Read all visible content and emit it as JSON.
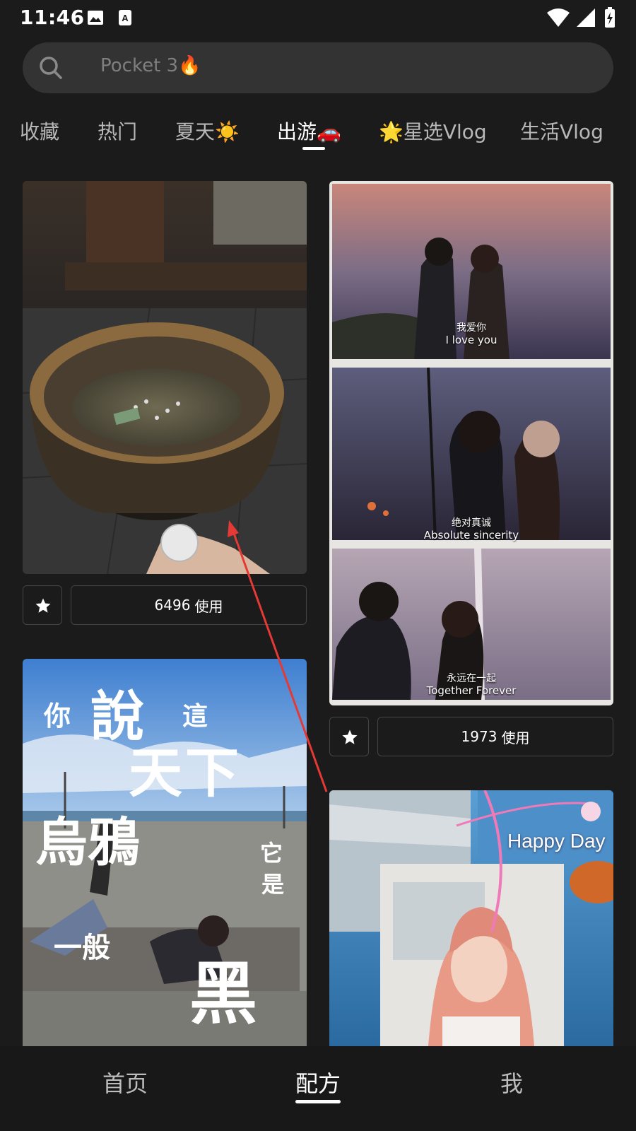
{
  "status_bar": {
    "time": "11:46",
    "icons": [
      "image-icon",
      "font-icon",
      "wifi-icon",
      "signal-icon",
      "battery-icon"
    ]
  },
  "search": {
    "placeholder": "Pocket 3🔥"
  },
  "tabs": [
    {
      "label": "收藏"
    },
    {
      "label": "热门"
    },
    {
      "label": "夏天☀️"
    },
    {
      "label": "出游🚗",
      "active": true
    },
    {
      "label": "🌟星选Vlog"
    },
    {
      "label": "生活Vlog"
    }
  ],
  "cards": {
    "left_1": {
      "use_count": "6496",
      "use_label": "使用"
    },
    "right_1": {
      "captions": [
        {
          "cn": "我爱你",
          "en": "I love you"
        },
        {
          "cn": "绝对真诚",
          "en": "Absolute sincerity"
        },
        {
          "cn": "永远在一起",
          "en": "Together Forever"
        }
      ],
      "use_count": "1973",
      "use_label": "使用"
    },
    "left_2": {
      "poster_text": [
        "你",
        "說",
        "這",
        "天下",
        "烏鴉",
        "它",
        "是",
        "一般",
        "黑"
      ]
    },
    "right_2": {
      "sticker_text": "Happy Day"
    }
  },
  "bottom_nav": [
    {
      "label": "首页"
    },
    {
      "label": "配方",
      "active": true
    },
    {
      "label": "我"
    }
  ],
  "colors": {
    "background": "#1b1b1b",
    "annotation_arrow": "#e53935"
  }
}
